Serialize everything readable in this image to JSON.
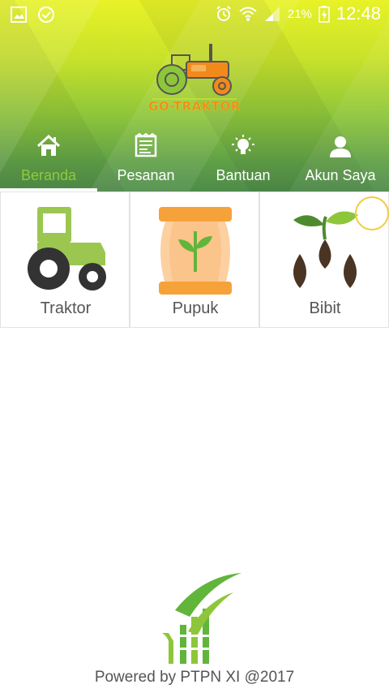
{
  "status_bar": {
    "battery_percent": "21%",
    "time": "12:48",
    "left_icons": [
      "gallery-icon",
      "check-circle-icon"
    ],
    "right_icons": [
      "alarm-icon",
      "wifi-icon",
      "signal-icon",
      "battery-charging-icon"
    ]
  },
  "logo": {
    "text": "GO-TRAKTOR"
  },
  "nav": {
    "items": [
      {
        "label": "Beranda",
        "icon": "home-icon",
        "active": true
      },
      {
        "label": "Pesanan",
        "icon": "receipt-icon",
        "active": false
      },
      {
        "label": "Bantuan",
        "icon": "lightbulb-icon",
        "active": false
      },
      {
        "label": "Akun Saya",
        "icon": "user-icon",
        "active": false
      }
    ]
  },
  "categories": [
    {
      "label": "Traktor",
      "icon": "tractor-icon"
    },
    {
      "label": "Pupuk",
      "icon": "fertilizer-bag-icon"
    },
    {
      "label": "Bibit",
      "icon": "seed-icon"
    }
  ],
  "footer": {
    "text": "Powered by PTPN XI @2017"
  },
  "colors": {
    "accent_green": "#8fcb3a",
    "header_top": "#e8f227",
    "header_bottom": "#4e8b4a"
  }
}
